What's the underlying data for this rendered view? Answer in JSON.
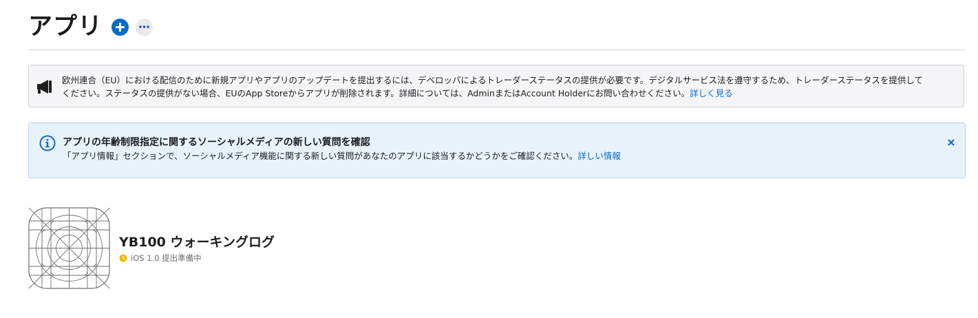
{
  "header": {
    "title": "アプリ"
  },
  "eu_notice": {
    "line1": "欧州連合（EU）における配信のために新規アプリやアプリのアップデートを提出するには、デベロッパによるトレーダーステータスの提供が必要です。デジタルサービス法を遵守するため、トレーダーステータスを提供して",
    "line2": "ください。ステータスの提供がない場合、EUのApp Storeからアプリが削除されます。詳細については、AdminまたはAccount Holderにお問い合わせください。",
    "link": "詳しく見る"
  },
  "info_banner": {
    "title": "アプリの年齢制限指定に関するソーシャルメディアの新しい質問を確認",
    "body": "「アプリ情報」セクションで、ソーシャルメディア機能に関する新しい質問があなたのアプリに該当するかどうかをご確認ください。",
    "link": "詳しい情報"
  },
  "apps": [
    {
      "name": "YB100 ウォーキングログ",
      "status": "iOS 1.0 提出準備中",
      "status_color": "#f5b800"
    }
  ],
  "colors": {
    "accent": "#0b6bcb",
    "status_pending": "#f5b800"
  },
  "icons": {
    "add": "plus-circle-icon",
    "more": "ellipsis-icon",
    "eu": "megaphone-icon",
    "info": "info-circle-icon",
    "close": "close-icon",
    "app": "app-placeholder-icon"
  }
}
